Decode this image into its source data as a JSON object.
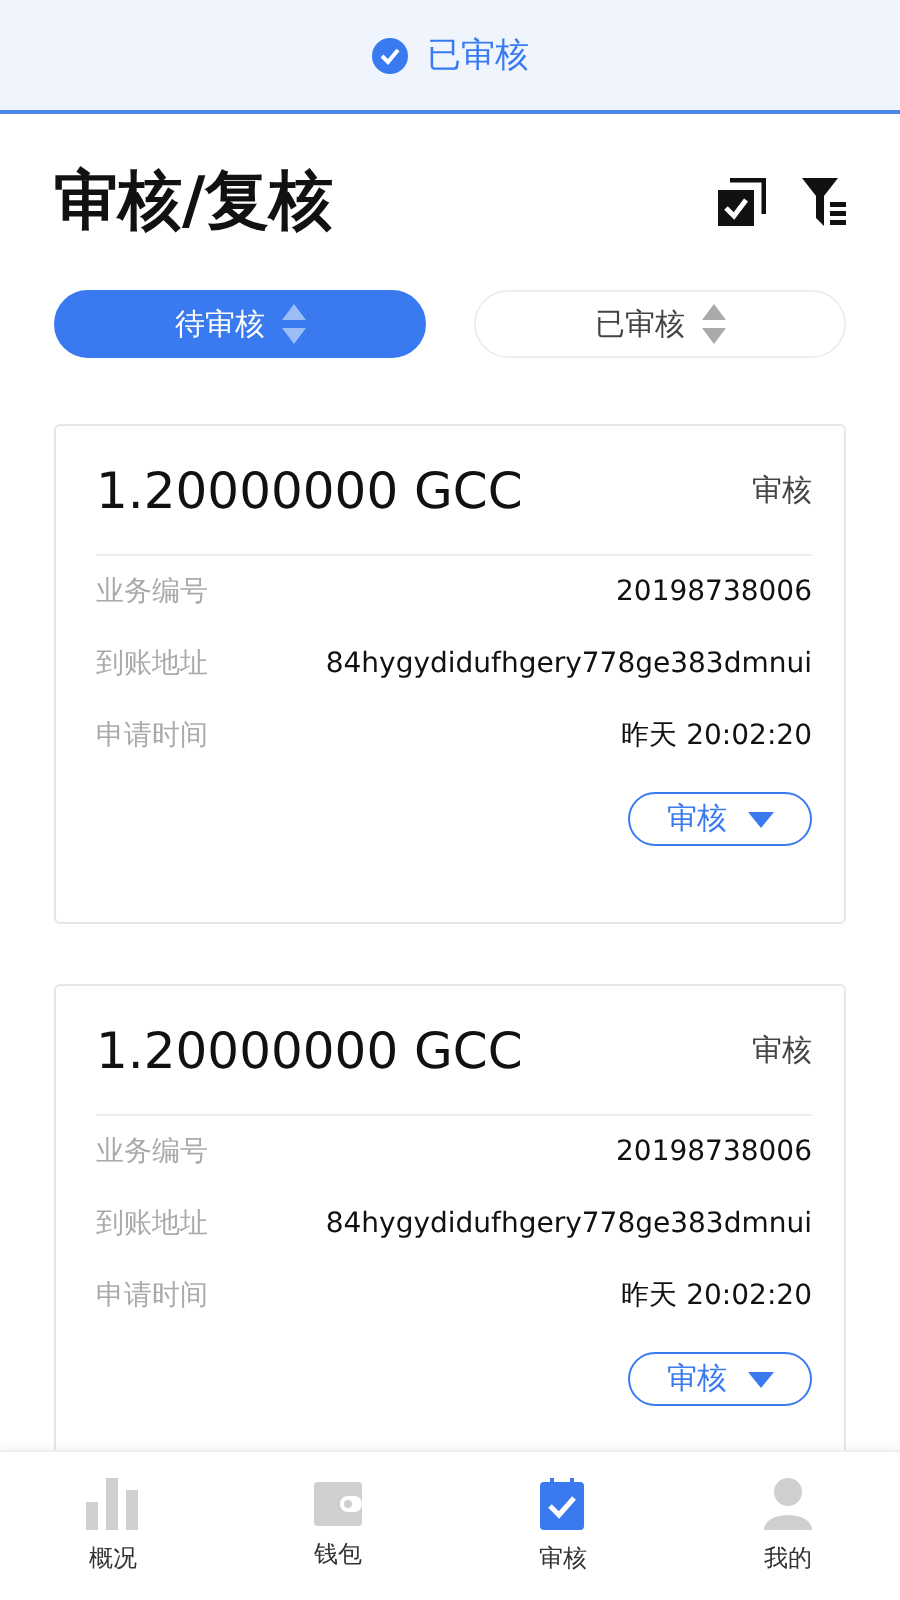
{
  "banner": {
    "label": "已审核"
  },
  "header": {
    "title": "审核/复核"
  },
  "filters": [
    {
      "label": "待审核",
      "selected": true
    },
    {
      "label": "已审核",
      "selected": false
    }
  ],
  "cards": [
    {
      "amount": "1.20000000 GCC",
      "status": "审核",
      "fields": [
        {
          "label": "业务编号",
          "value": "20198738006"
        },
        {
          "label": "到账地址",
          "value": "84hygydidufhgery778ge383dmnui"
        },
        {
          "label": "申请时间",
          "value": "昨天 20:02:20"
        }
      ],
      "action": "审核"
    },
    {
      "amount": "1.20000000 GCC",
      "status": "审核",
      "fields": [
        {
          "label": "业务编号",
          "value": "20198738006"
        },
        {
          "label": "到账地址",
          "value": "84hygydidufhgery778ge383dmnui"
        },
        {
          "label": "申请时间",
          "value": "昨天 20:02:20"
        }
      ],
      "action": "审核"
    }
  ],
  "tab_bar": [
    {
      "kind": "chart",
      "label": "概况",
      "selected": false
    },
    {
      "kind": "wallet",
      "label": "钱包",
      "selected": false
    },
    {
      "kind": "review",
      "label": "审核",
      "selected": true
    },
    {
      "kind": "profile",
      "label": "我的",
      "selected": false
    }
  ]
}
